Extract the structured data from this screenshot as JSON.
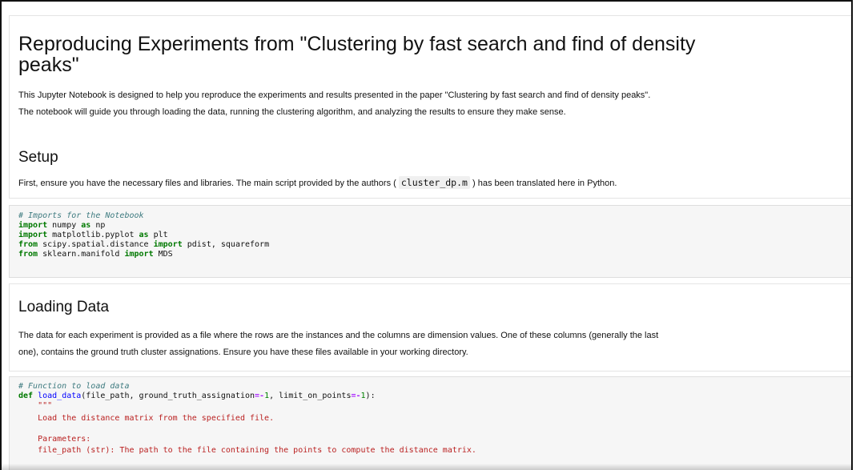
{
  "intro": {
    "title_line1": "Reproducing Experiments from \"Clustering by fast search and find of density",
    "title_line2": "peaks\"",
    "para_line1": "This Jupyter Notebook is designed to help you reproduce the experiments and results presented in the paper \"Clustering by fast search and find of density peaks\".",
    "para_line2": "The notebook will guide you through loading the data, running the clustering algorithm, and analyzing the results to ensure they make sense.",
    "setup_heading": "Setup",
    "setup_text_before": "First, ensure you have the necessary files and libraries. The main script provided by the authors ( ",
    "setup_code": "cluster_dp.m",
    "setup_text_after": " ) has been translated here in Python."
  },
  "imports_cell": {
    "comment": "# Imports for the Notebook",
    "l1_kw": "import",
    "l1_mod": " numpy ",
    "l1_as": "as",
    "l1_alias": " np",
    "l2_kw": "import",
    "l2_mod": " matplotlib.pyplot ",
    "l2_as": "as",
    "l2_alias": " plt",
    "l3_from": "from",
    "l3_mod": " scipy.spatial.distance ",
    "l3_import": "import",
    "l3_names": " pdist, squareform",
    "l4_from": "from",
    "l4_mod": " sklearn.manifold ",
    "l4_import": "import",
    "l4_names": " MDS"
  },
  "loading": {
    "heading": "Loading Data",
    "para_line1": "The data for each experiment is provided as a file where the rows are the instances and the columns are dimension values. One of these columns (generally the last",
    "para_line2": "one), contains the ground truth cluster assignations. Ensure you have these files available in your working directory."
  },
  "load_cell": {
    "comment": "# Function to load data",
    "def_kw": "def",
    "fn_name": "load_data",
    "sig_a": "(file_path, ground_truth_assignation",
    "eq1": "=-",
    "num1": "1",
    "sig_b": ", limit_on_points",
    "eq2": "=-",
    "num2": "1",
    "sig_c": "):",
    "docquote": "    \"\"\"",
    "doc1": "    Load the distance matrix from the specified file.",
    "doc2": "    Parameters:",
    "doc3": "    file_path (str): The path to the file containing the points to compute the distance matrix."
  }
}
